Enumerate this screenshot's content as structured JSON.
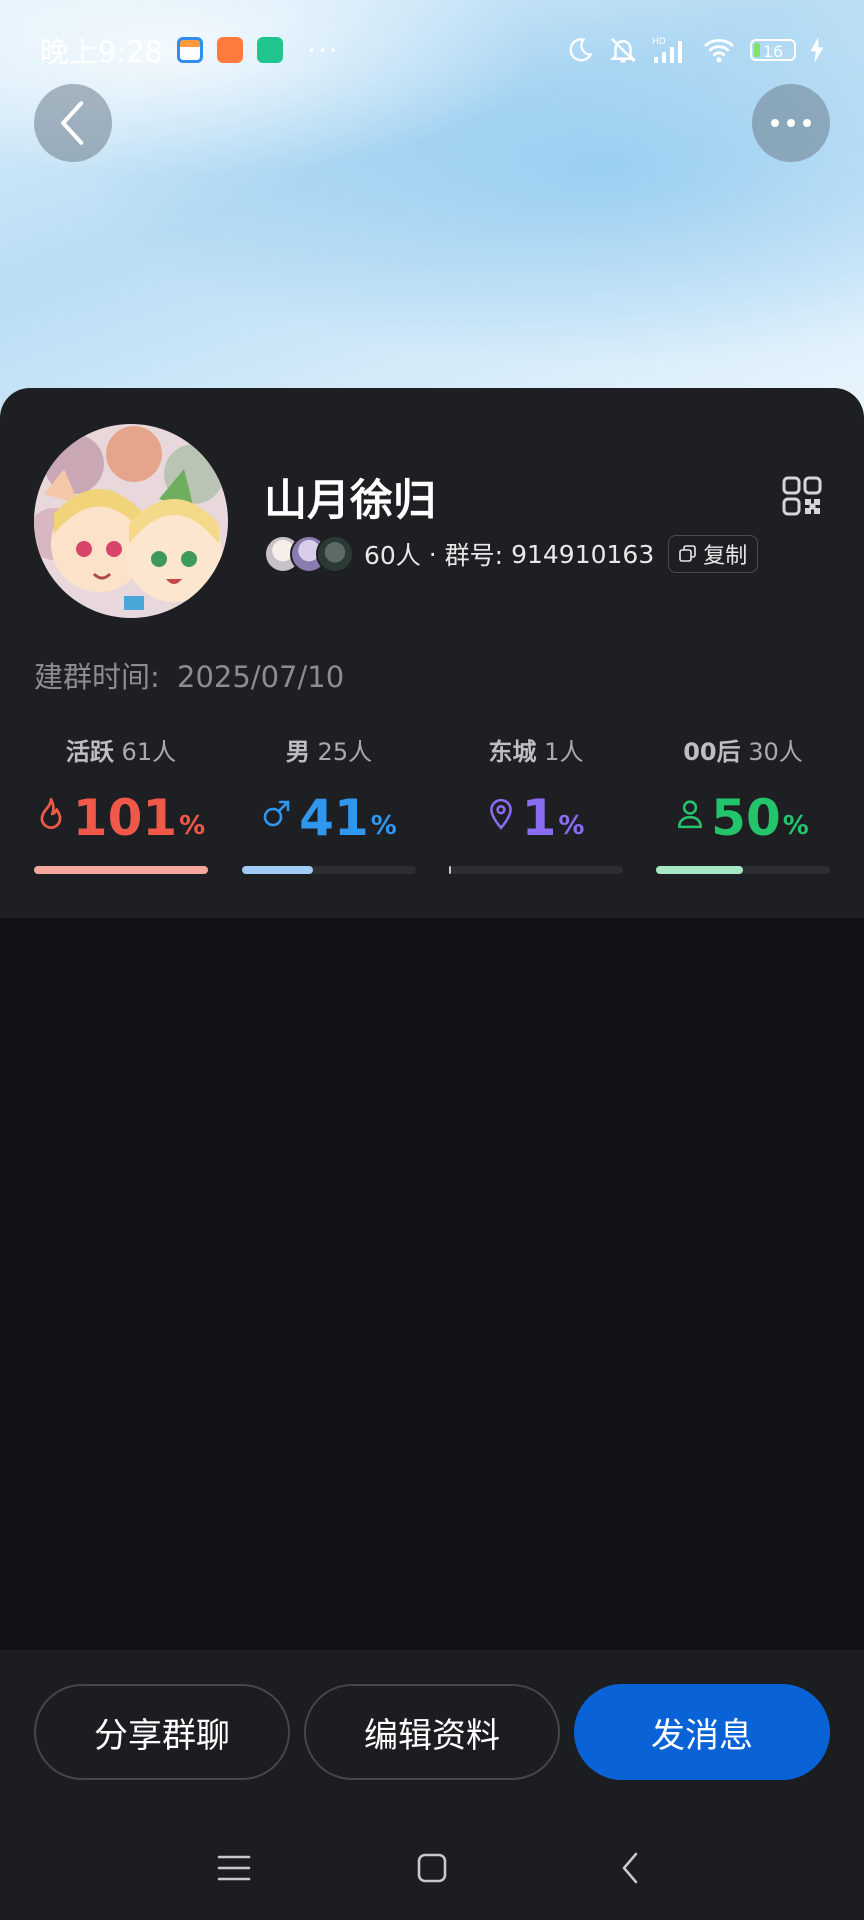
{
  "status_bar": {
    "time": "晚上9:28",
    "more": "···",
    "battery": "16"
  },
  "header": {
    "back_icon": "chevron-left-icon",
    "more_icon": "more-horizontal-icon"
  },
  "group": {
    "name": "山月徐归",
    "members": "60人",
    "separator": " · ",
    "id_label": "群号:",
    "id_value": "914910163",
    "copy_label": "复制",
    "created_label": "建群时间:",
    "created_value": "2025/07/10"
  },
  "stats": [
    {
      "label": "活跃",
      "count": "61人",
      "value": "101",
      "unit": "%",
      "icon": "flame-icon",
      "color": "#f0594a",
      "bar_color": "#f6a79c",
      "fraction": 1.0
    },
    {
      "label": "男",
      "count": "25人",
      "value": "41",
      "unit": "%",
      "icon": "male-icon",
      "color": "#2f97ee",
      "bar_color": "#9fcbf6",
      "fraction": 0.41
    },
    {
      "label": "东城",
      "count": "1人",
      "value": "1",
      "unit": "%",
      "icon": "location-pin-icon",
      "color": "#8a6cf0",
      "bar_color": "#c8c8cc",
      "fraction": 0.01
    },
    {
      "label": "00后",
      "count": "30人",
      "value": "50",
      "unit": "%",
      "icon": "person-icon",
      "color": "#23c46b",
      "bar_color": "#a7e8c4",
      "fraction": 0.5
    }
  ],
  "actions": {
    "share": "分享群聊",
    "edit": "编辑资料",
    "message": "发消息"
  },
  "nav": {
    "menu_icon": "menu-icon",
    "home_icon": "home-square-icon",
    "back_icon": "back-chevron-icon"
  }
}
